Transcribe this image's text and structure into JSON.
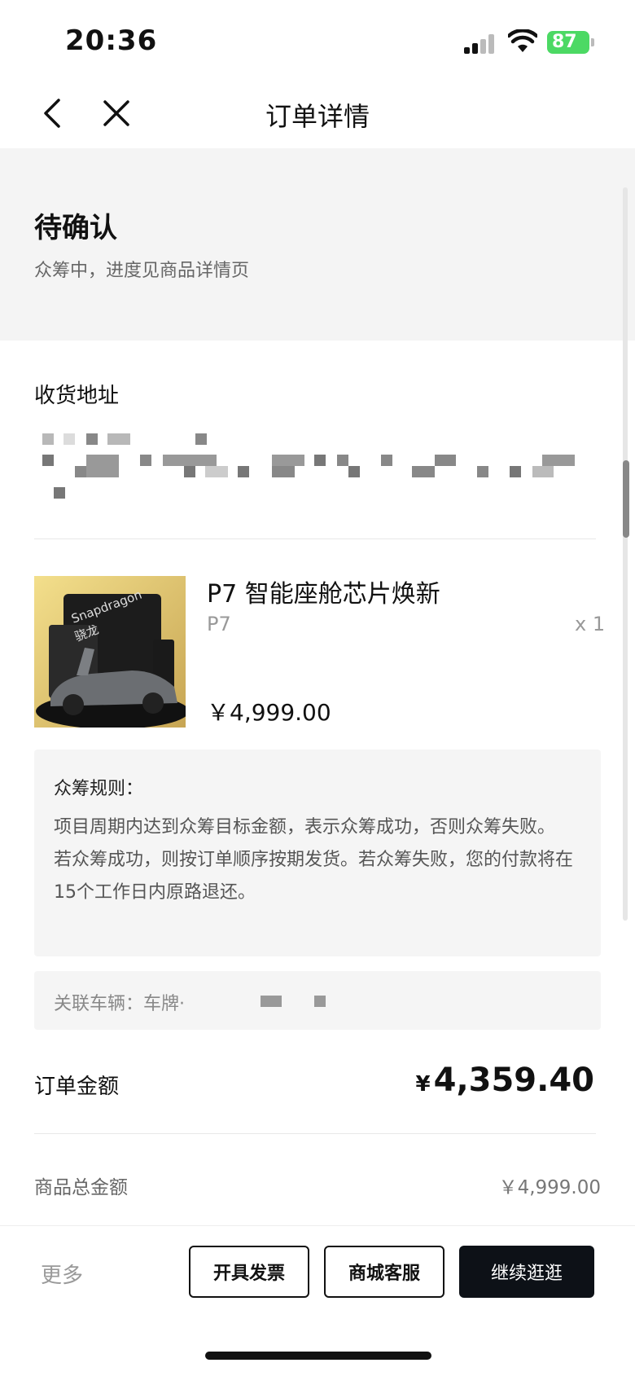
{
  "status_bar": {
    "time": "20:36",
    "battery": "87"
  },
  "nav": {
    "title": "订单详情"
  },
  "order_status": {
    "title": "待确认",
    "subtitle": "众筹中，进度见商品详情页"
  },
  "address": {
    "title": "收货地址"
  },
  "product": {
    "name": "P7 智能座舱芯片焕新",
    "variant": "P7",
    "quantity": "x 1",
    "price": "￥4,999.00",
    "image_text": [
      "Snapdragon",
      "骁龙"
    ]
  },
  "rules": {
    "title": "众筹规则：",
    "text": "项目周期内达到众筹目标金额，表示众筹成功，否则众筹失败。\n若众筹成功，则按订单顺序按期发货。若众筹失败，您的付款将在15个工作日内原路退还。"
  },
  "vehicle": {
    "label": "关联车辆：车牌·"
  },
  "order_amount": {
    "label": "订单金额",
    "currency": "¥",
    "value": "4,359.40"
  },
  "summary": {
    "label": "商品总金额",
    "value": "￥4,999.00"
  },
  "bottom_bar": {
    "more": "更多",
    "invoice": "开具发票",
    "service": "商城客服",
    "continue": "继续逛逛"
  },
  "colors": {
    "battery": "#4cd964",
    "primary_button": "#0d1117",
    "status_background": "#f4f4f4"
  }
}
